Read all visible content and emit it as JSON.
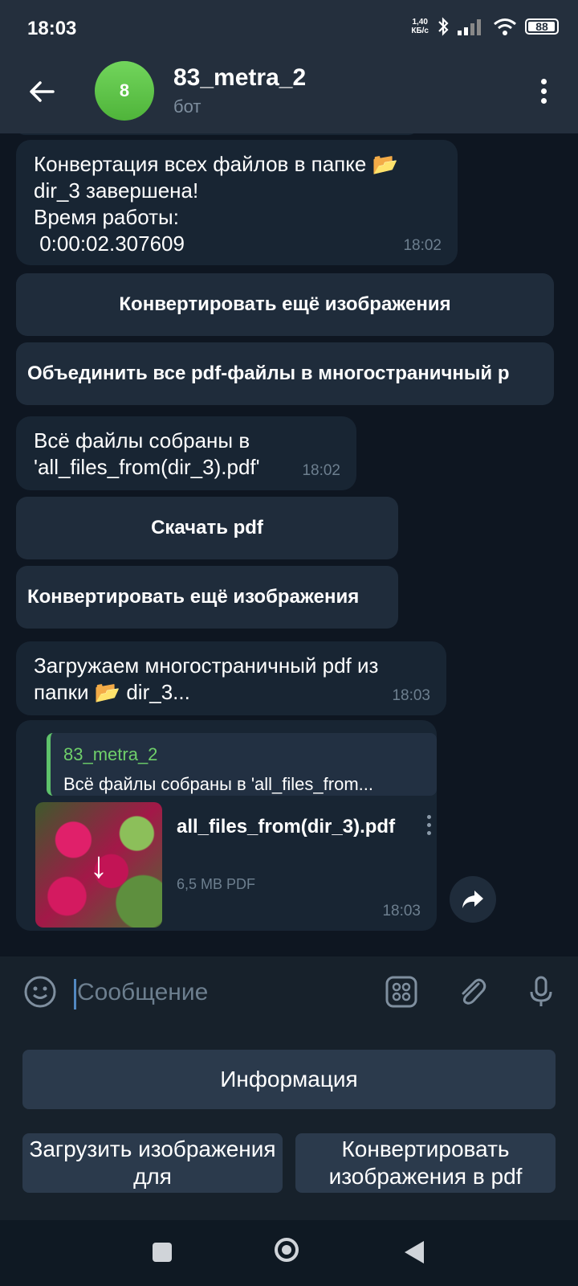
{
  "status_bar": {
    "time": "18:03",
    "speed_value": "1,40",
    "speed_unit": "КБ/с",
    "battery": "88"
  },
  "header": {
    "avatar_letter": "8",
    "title": "83_metra_2",
    "subtitle": "бот"
  },
  "messages": {
    "m1": {
      "text_line1": "Конвертация всех файлов в папке 📂",
      "text_line2": "dir_3 завершена!",
      "text_line3": "Время работы:",
      "text_line4": " 0:00:02.307609",
      "time": "18:02",
      "buttons": [
        "Конвертировать ещё изображения",
        "Объединить все pdf-файлы в многостраничный р"
      ]
    },
    "m2": {
      "text_line1": "Всё файлы собраны в",
      "text_line2": "'all_files_from(dir_3).pdf'",
      "time": "18:02",
      "buttons": [
        "Скачать pdf",
        "Конвертировать ещё изображения"
      ]
    },
    "m3": {
      "text_line1": "Загружаем многостраничный pdf из",
      "text_line2": "папки 📂 dir_3...",
      "time": "18:03"
    },
    "m4": {
      "reply_name": "83_metra_2",
      "reply_text": "Всё файлы собраны в 'all_files_from...",
      "file_name": "all_files_from(dir_3).pdf",
      "file_size": "6,5 MB PDF",
      "time": "18:03"
    }
  },
  "input": {
    "placeholder": "Сообщение"
  },
  "keyboard": {
    "info": "Информация",
    "upload": "Загрузить изображения для",
    "convert": "Конвертировать изображения в pdf"
  },
  "colors": {
    "background": "#0e1621",
    "header": "#242f3d",
    "bubble": "#182533",
    "accent_green": "#5ec26b",
    "accent_blue": "#5288c1"
  }
}
